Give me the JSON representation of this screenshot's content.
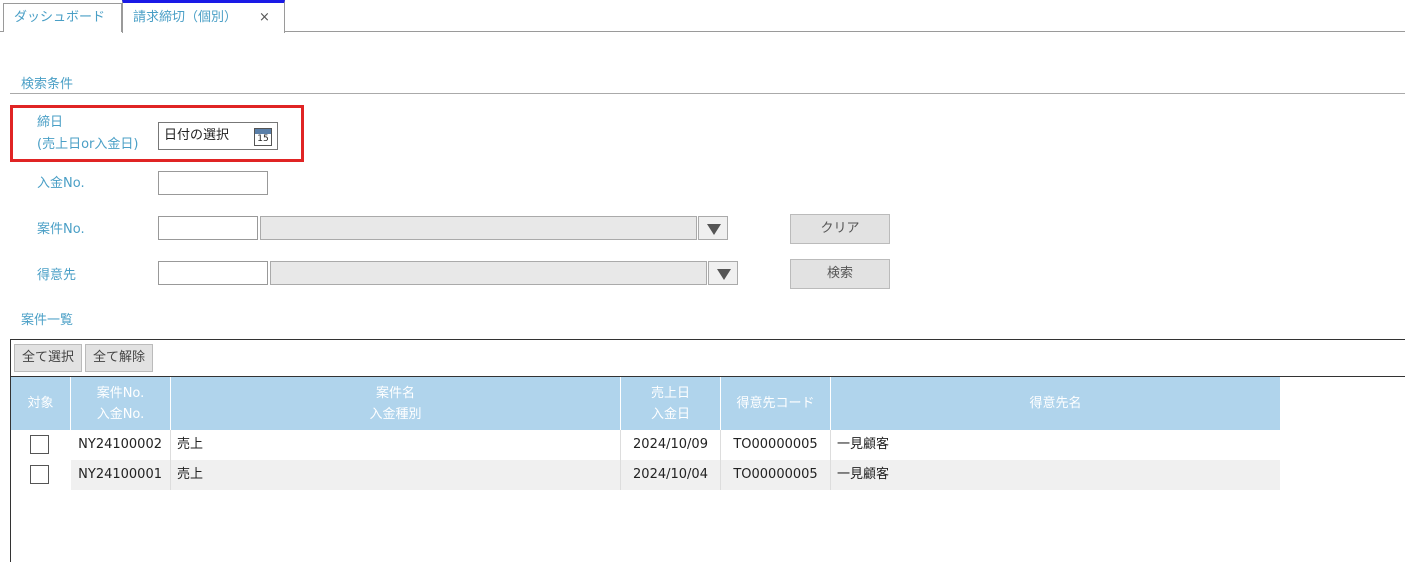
{
  "tabs": [
    {
      "label": "ダッシュボード"
    },
    {
      "label": "請求締切（個別）",
      "close": "×"
    }
  ],
  "search": {
    "section_title": "検索条件",
    "closing_date": {
      "label_line1": "締日",
      "label_line2": "(売上日or入金日)",
      "value": "日付の選択",
      "calendar_number": "15"
    },
    "payment_no_label": "入金No.",
    "project_no_label": "案件No.",
    "customer_label": "得意先",
    "clear_button": "クリア",
    "search_button": "検索"
  },
  "list": {
    "section_title": "案件一覧",
    "select_all": "全て選択",
    "deselect_all": "全て解除",
    "columns": [
      {
        "line1": "対象",
        "line2": ""
      },
      {
        "line1": "案件No.",
        "line2": "入金No."
      },
      {
        "line1": "案件名",
        "line2": "入金種別"
      },
      {
        "line1": "売上日",
        "line2": "入金日"
      },
      {
        "line1": "得意先コード",
        "line2": ""
      },
      {
        "line1": "得意先名",
        "line2": ""
      }
    ],
    "rows": [
      {
        "project_no": "NY24100002",
        "name": "売上",
        "date": "2024/10/09",
        "customer_code": "TO00000005",
        "customer_name": "一見顧客"
      },
      {
        "project_no": "NY24100001",
        "name": "売上",
        "date": "2024/10/04",
        "customer_code": "TO00000005",
        "customer_name": "一見顧客"
      }
    ]
  }
}
